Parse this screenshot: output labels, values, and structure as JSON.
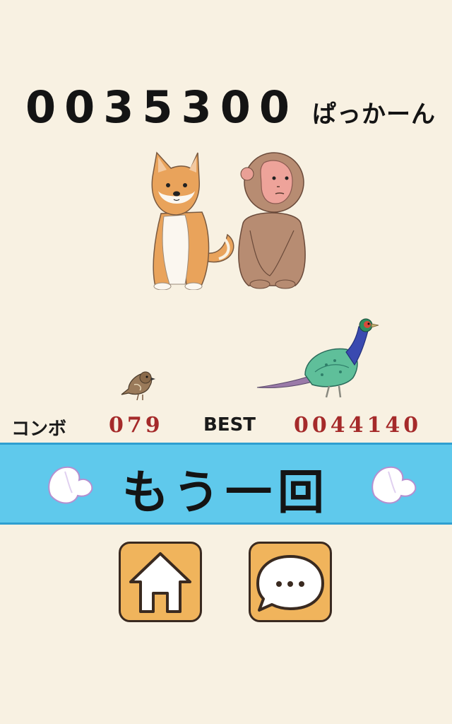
{
  "game": {
    "score": "0035300",
    "score_suffix": "ぱっかーん"
  },
  "stats": {
    "combo_label": "コンボ",
    "combo_value": "079",
    "best_label": "BEST",
    "best_value": "0044140"
  },
  "retry": {
    "label": "もう一回"
  },
  "colors": {
    "background": "#f8f1e2",
    "retry_bar": "#5fc9ec",
    "button_fill": "#f0b45c",
    "value_red": "#a52a2a"
  },
  "icons": {
    "home": "home-icon",
    "chat": "speech-bubble-icon",
    "peach": "peach-icon"
  }
}
